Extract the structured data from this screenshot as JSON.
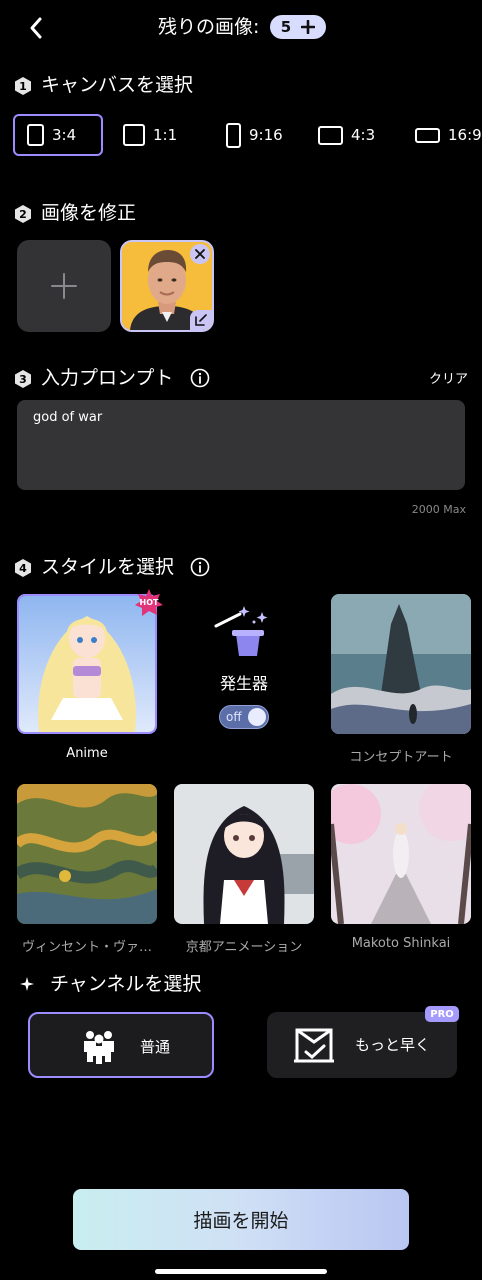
{
  "header": {
    "title": "残りの画像:",
    "credits": "5",
    "back_icon": "chevron-left-icon",
    "add_icon": "plus-icon"
  },
  "sections": {
    "canvas": {
      "number": "1",
      "title": "キャンバスを選択"
    },
    "modify": {
      "number": "2",
      "title": "画像を修正"
    },
    "prompt": {
      "number": "3",
      "title": "入力プロンプト"
    },
    "style": {
      "number": "4",
      "title": "スタイルを選択"
    },
    "channel": {
      "title": "チャンネルを選択"
    }
  },
  "canvas_options": [
    {
      "label": "3:4",
      "selected": true
    },
    {
      "label": "1:1",
      "selected": false
    },
    {
      "label": "9:16",
      "selected": false
    },
    {
      "label": "4:3",
      "selected": false
    },
    {
      "label": "16:9",
      "selected": false
    }
  ],
  "prompt": {
    "value": "god of war",
    "clear_label": "クリア",
    "max_label": "2000 Max"
  },
  "styles": [
    {
      "label": "Anime",
      "selected": true,
      "badge": "HOT"
    },
    {
      "label": "コンセプトアート",
      "selected": false
    },
    {
      "label": "ヴィンセント・ヴァ…",
      "selected": false
    },
    {
      "label": "京都アニメーション",
      "selected": false
    },
    {
      "label": "Makoto Shinkai",
      "selected": false
    }
  ],
  "generator": {
    "label": "発生器",
    "toggle_label": "off"
  },
  "channels": {
    "normal_label": "普通",
    "fast_label": "もっと早く",
    "pro_badge": "PRO"
  },
  "start_button": "描画を開始",
  "colors": {
    "accent": "#9b8cff",
    "background": "#000000",
    "surface": "#343437",
    "badge_hot": "#e0337a"
  }
}
